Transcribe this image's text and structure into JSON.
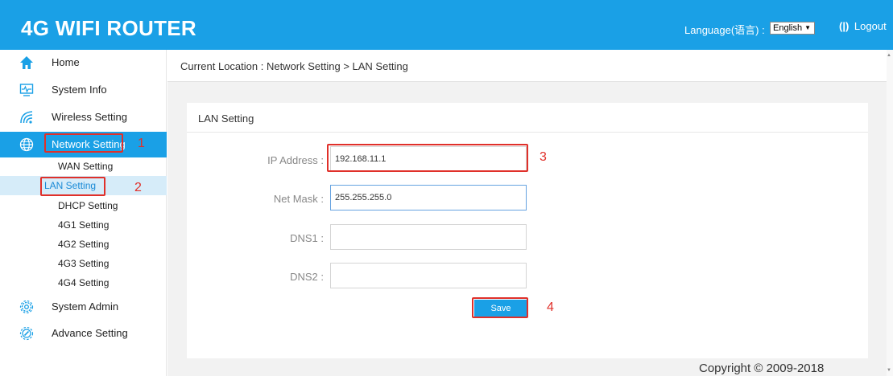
{
  "header": {
    "brand": "4G WIFI ROUTER",
    "language_label": "Language(语言) :",
    "language_value": "English",
    "logout_icon": "(|)",
    "logout_label": "Logout"
  },
  "sidebar": {
    "items": [
      {
        "label": "Home",
        "icon": "home-icon"
      },
      {
        "label": "System Info",
        "icon": "monitor-icon"
      },
      {
        "label": "Wireless Setting",
        "icon": "wifi-icon"
      },
      {
        "label": "Network Setting",
        "icon": "globe-icon"
      },
      {
        "label": "System Admin",
        "icon": "gear-icon"
      },
      {
        "label": "Advance Setting",
        "icon": "gear-wrench-icon"
      }
    ],
    "subitems": [
      "WAN Setting",
      "LAN Setting",
      "DHCP Setting",
      "4G1 Setting",
      "4G2 Setting",
      "4G3 Setting",
      "4G4 Setting"
    ]
  },
  "markers": [
    "1",
    "2",
    "3",
    "4"
  ],
  "breadcrumb": "Current Location : Network Setting > LAN Setting",
  "panel": {
    "title": "LAN Setting",
    "fields": [
      {
        "label": "IP Address :",
        "value": "192.168.11.1"
      },
      {
        "label": "Net Mask :",
        "value": "255.255.255.0"
      },
      {
        "label": "DNS1 :",
        "value": ""
      },
      {
        "label": "DNS2 :",
        "value": ""
      }
    ],
    "save_label": "Save"
  },
  "footer": {
    "copyright": "Copyright © 2009-2018"
  },
  "colors": {
    "accent": "#1aa0e6",
    "annotation": "#e0302a"
  }
}
